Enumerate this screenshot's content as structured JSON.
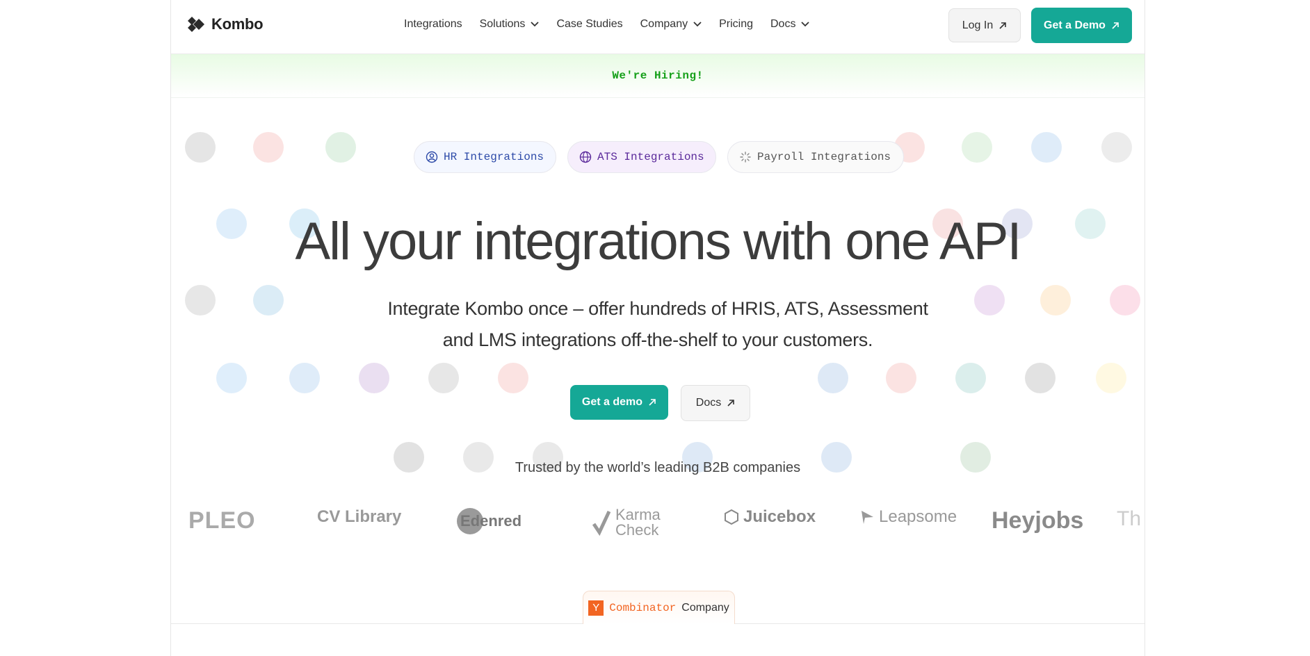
{
  "brand": {
    "name": "Kombo"
  },
  "nav": {
    "items": [
      {
        "label": "Integrations",
        "has_dropdown": false
      },
      {
        "label": "Solutions",
        "has_dropdown": true
      },
      {
        "label": "Case Studies",
        "has_dropdown": false
      },
      {
        "label": "Company",
        "has_dropdown": true
      },
      {
        "label": "Pricing",
        "has_dropdown": false
      },
      {
        "label": "Docs",
        "has_dropdown": true
      }
    ],
    "login_label": "Log In",
    "demo_label": "Get a Demo"
  },
  "banner": {
    "text": "We're Hiring!"
  },
  "pills": {
    "hr": "HR Integrations",
    "ats": "ATS Integrations",
    "payroll": "Payroll Integrations"
  },
  "hero": {
    "headline": "All your integrations with one API",
    "sub_line1": "Integrate Kombo once – offer hundreds of HRIS, ATS, Assessment",
    "sub_line2": "and LMS integrations off-the-shelf to your customers.",
    "cta_demo": "Get a demo",
    "cta_docs": "Docs"
  },
  "trusted": {
    "caption": "Trusted by the world’s leading B2B companies",
    "logos": [
      "PLEO",
      "CV Library",
      "Edenred",
      "Karma Check",
      "Juicebox",
      "Leapsome",
      "Heyjobs",
      "Th"
    ]
  },
  "yc_badge": {
    "y": "Y",
    "combinator": "Combinator",
    "company": "Company"
  },
  "colors": {
    "accent": "#15a896",
    "hiring_green": "#16a01a",
    "yc_orange": "#f26522"
  }
}
